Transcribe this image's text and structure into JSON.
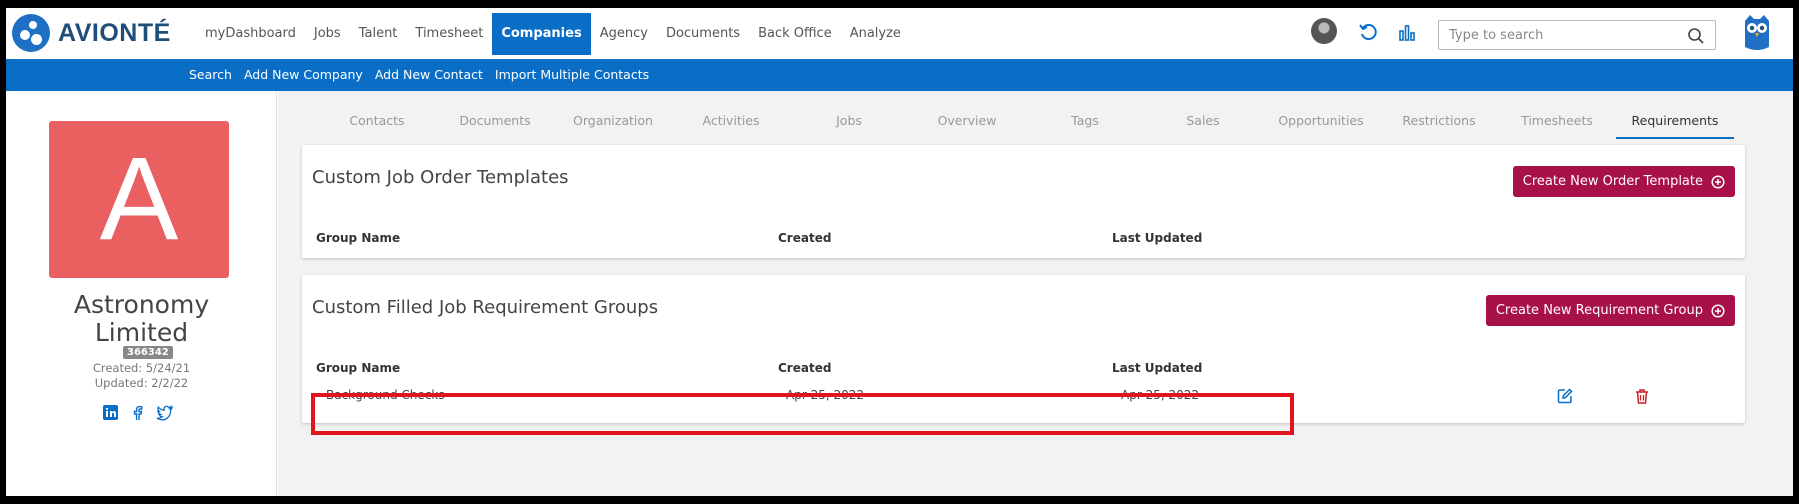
{
  "app": {
    "brand": "AVIONTÉ"
  },
  "nav": {
    "items": [
      "myDashboard",
      "Jobs",
      "Talent",
      "Timesheet",
      "Companies",
      "Agency",
      "Documents",
      "Back Office",
      "Analyze"
    ],
    "active": "Companies"
  },
  "search": {
    "placeholder": "Type to search",
    "value": ""
  },
  "subnav": {
    "items": [
      "Search",
      "Add New Company",
      "Add New Contact",
      "Import Multiple Contacts"
    ]
  },
  "company": {
    "initial": "A",
    "name_line1": "Astronomy",
    "name_line2": "Limited",
    "id": "366342",
    "created": "Created: 5/24/21",
    "updated": "Updated: 2/2/22",
    "social": [
      "linkedin-icon",
      "facebook-icon",
      "twitter-icon"
    ]
  },
  "tabs": {
    "items": [
      "Contacts",
      "Documents",
      "Organization",
      "Activities",
      "Jobs",
      "Overview",
      "Tags",
      "Sales",
      "Opportunities",
      "Restrictions",
      "Timesheets",
      "Requirements"
    ],
    "active": "Requirements"
  },
  "templates": {
    "title": "Custom Job Order Templates",
    "button": "Create New Order Template",
    "columns": [
      "Group Name",
      "Created",
      "Last Updated"
    ]
  },
  "requirements": {
    "title": "Custom Filled Job Requirement Groups",
    "button": "Create New Requirement Group",
    "columns": [
      "Group Name",
      "Created",
      "Last Updated"
    ],
    "rows": [
      {
        "group_name": "Background Checks",
        "created": "Apr 25, 2022",
        "last_updated": "Apr 25, 2022"
      }
    ]
  },
  "colors": {
    "primary": "#0a6ec6",
    "button": "#a8104a",
    "avatar": "#ea5f60",
    "highlight": "#e0151e"
  }
}
